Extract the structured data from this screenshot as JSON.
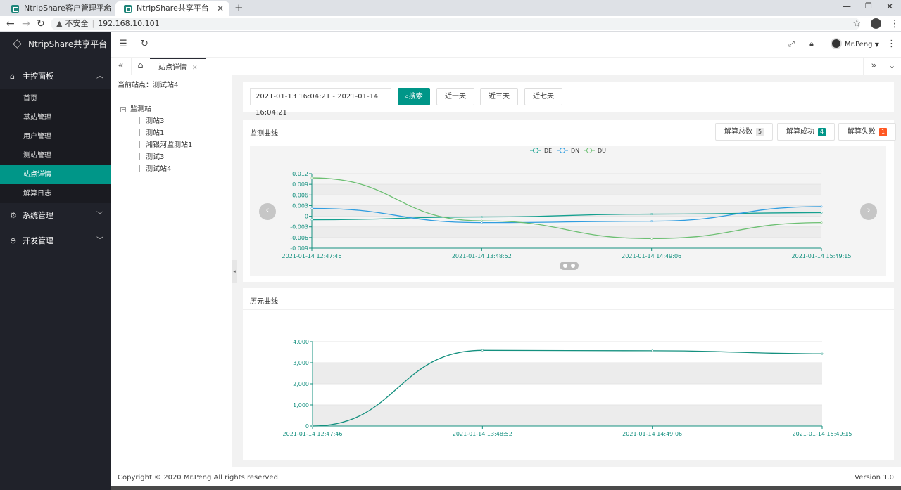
{
  "browser": {
    "tabs": [
      {
        "title": "NtripShare客户管理平台"
      },
      {
        "title": "NtripShare共享平台"
      }
    ],
    "security_label": "不安全",
    "url": "192.168.10.101"
  },
  "sidebar": {
    "brand": "NtripShare共享平台",
    "groups": [
      {
        "label": "主控面板",
        "items": [
          "首页",
          "基站管理",
          "用户管理",
          "测站管理",
          "站点详情",
          "解算日志"
        ]
      },
      {
        "label": "系统管理"
      },
      {
        "label": "开发管理"
      }
    ],
    "active_item": "站点详情"
  },
  "header": {
    "user": "Mr.Peng"
  },
  "tabstrip": {
    "active_tab": "站点详情"
  },
  "tree": {
    "current_label": "当前站点：测试站4",
    "root": "监测站",
    "leaves": [
      "测站3",
      "测站1",
      "湘银河监测站1",
      "测试3",
      "测试站4"
    ]
  },
  "search": {
    "date_range": "2021-01-13 16:04:21 - 2021-01-14 16:04:21",
    "search_label": "搜索",
    "quick": [
      "近一天",
      "近三天",
      "近七天"
    ]
  },
  "monitor": {
    "title": "监测曲线",
    "counters": [
      {
        "label": "解算总数",
        "value": "5",
        "color": "#e6e6e6",
        "text_color": "#333333"
      },
      {
        "label": "解算成功",
        "value": "4",
        "color": "#009688",
        "text_color": "#ffffff"
      },
      {
        "label": "解算失败",
        "value": "1",
        "color": "#ff5722",
        "text_color": "#ffffff"
      }
    ]
  },
  "history": {
    "title": "历元曲线"
  },
  "footer": {
    "copyright": "Copyright © 2020 Mr.Peng All rights reserved.",
    "version": "Version 1.0"
  },
  "chart_data": [
    {
      "type": "line",
      "x": [
        "2021-01-14 12:47:46",
        "2021-01-14 13:48:52",
        "2021-01-14 14:49:06",
        "2021-01-14 15:49:15"
      ],
      "series": [
        {
          "name": "DE",
          "color": "#14a08f",
          "values": [
            -0.001,
            -0.0002,
            0.0006,
            0.001
          ]
        },
        {
          "name": "DN",
          "color": "#2f9de0",
          "values": [
            0.0022,
            -0.0018,
            -0.0014,
            0.0027
          ]
        },
        {
          "name": "DU",
          "color": "#6cbf72",
          "values": [
            0.0108,
            -0.0013,
            -0.0063,
            -0.0018
          ]
        }
      ],
      "y_ticks": [
        "0.012",
        "0.009",
        "0.006",
        "0.003",
        "0",
        "-0.003",
        "-0.006",
        "-0.009"
      ],
      "ylim": [
        -0.009,
        0.012
      ],
      "legend": "top-center"
    },
    {
      "type": "line",
      "x": [
        "2021-01-14 12:47:46",
        "2021-01-14 13:48:52",
        "2021-01-14 14:49:06",
        "2021-01-14 15:49:15"
      ],
      "series": [
        {
          "color": "#14907f",
          "values": [
            0,
            3590,
            3570,
            3430
          ]
        }
      ],
      "y_ticks": [
        "4,000",
        "3,000",
        "2,000",
        "1,000",
        "0"
      ],
      "ylim": [
        0,
        4000
      ]
    }
  ]
}
